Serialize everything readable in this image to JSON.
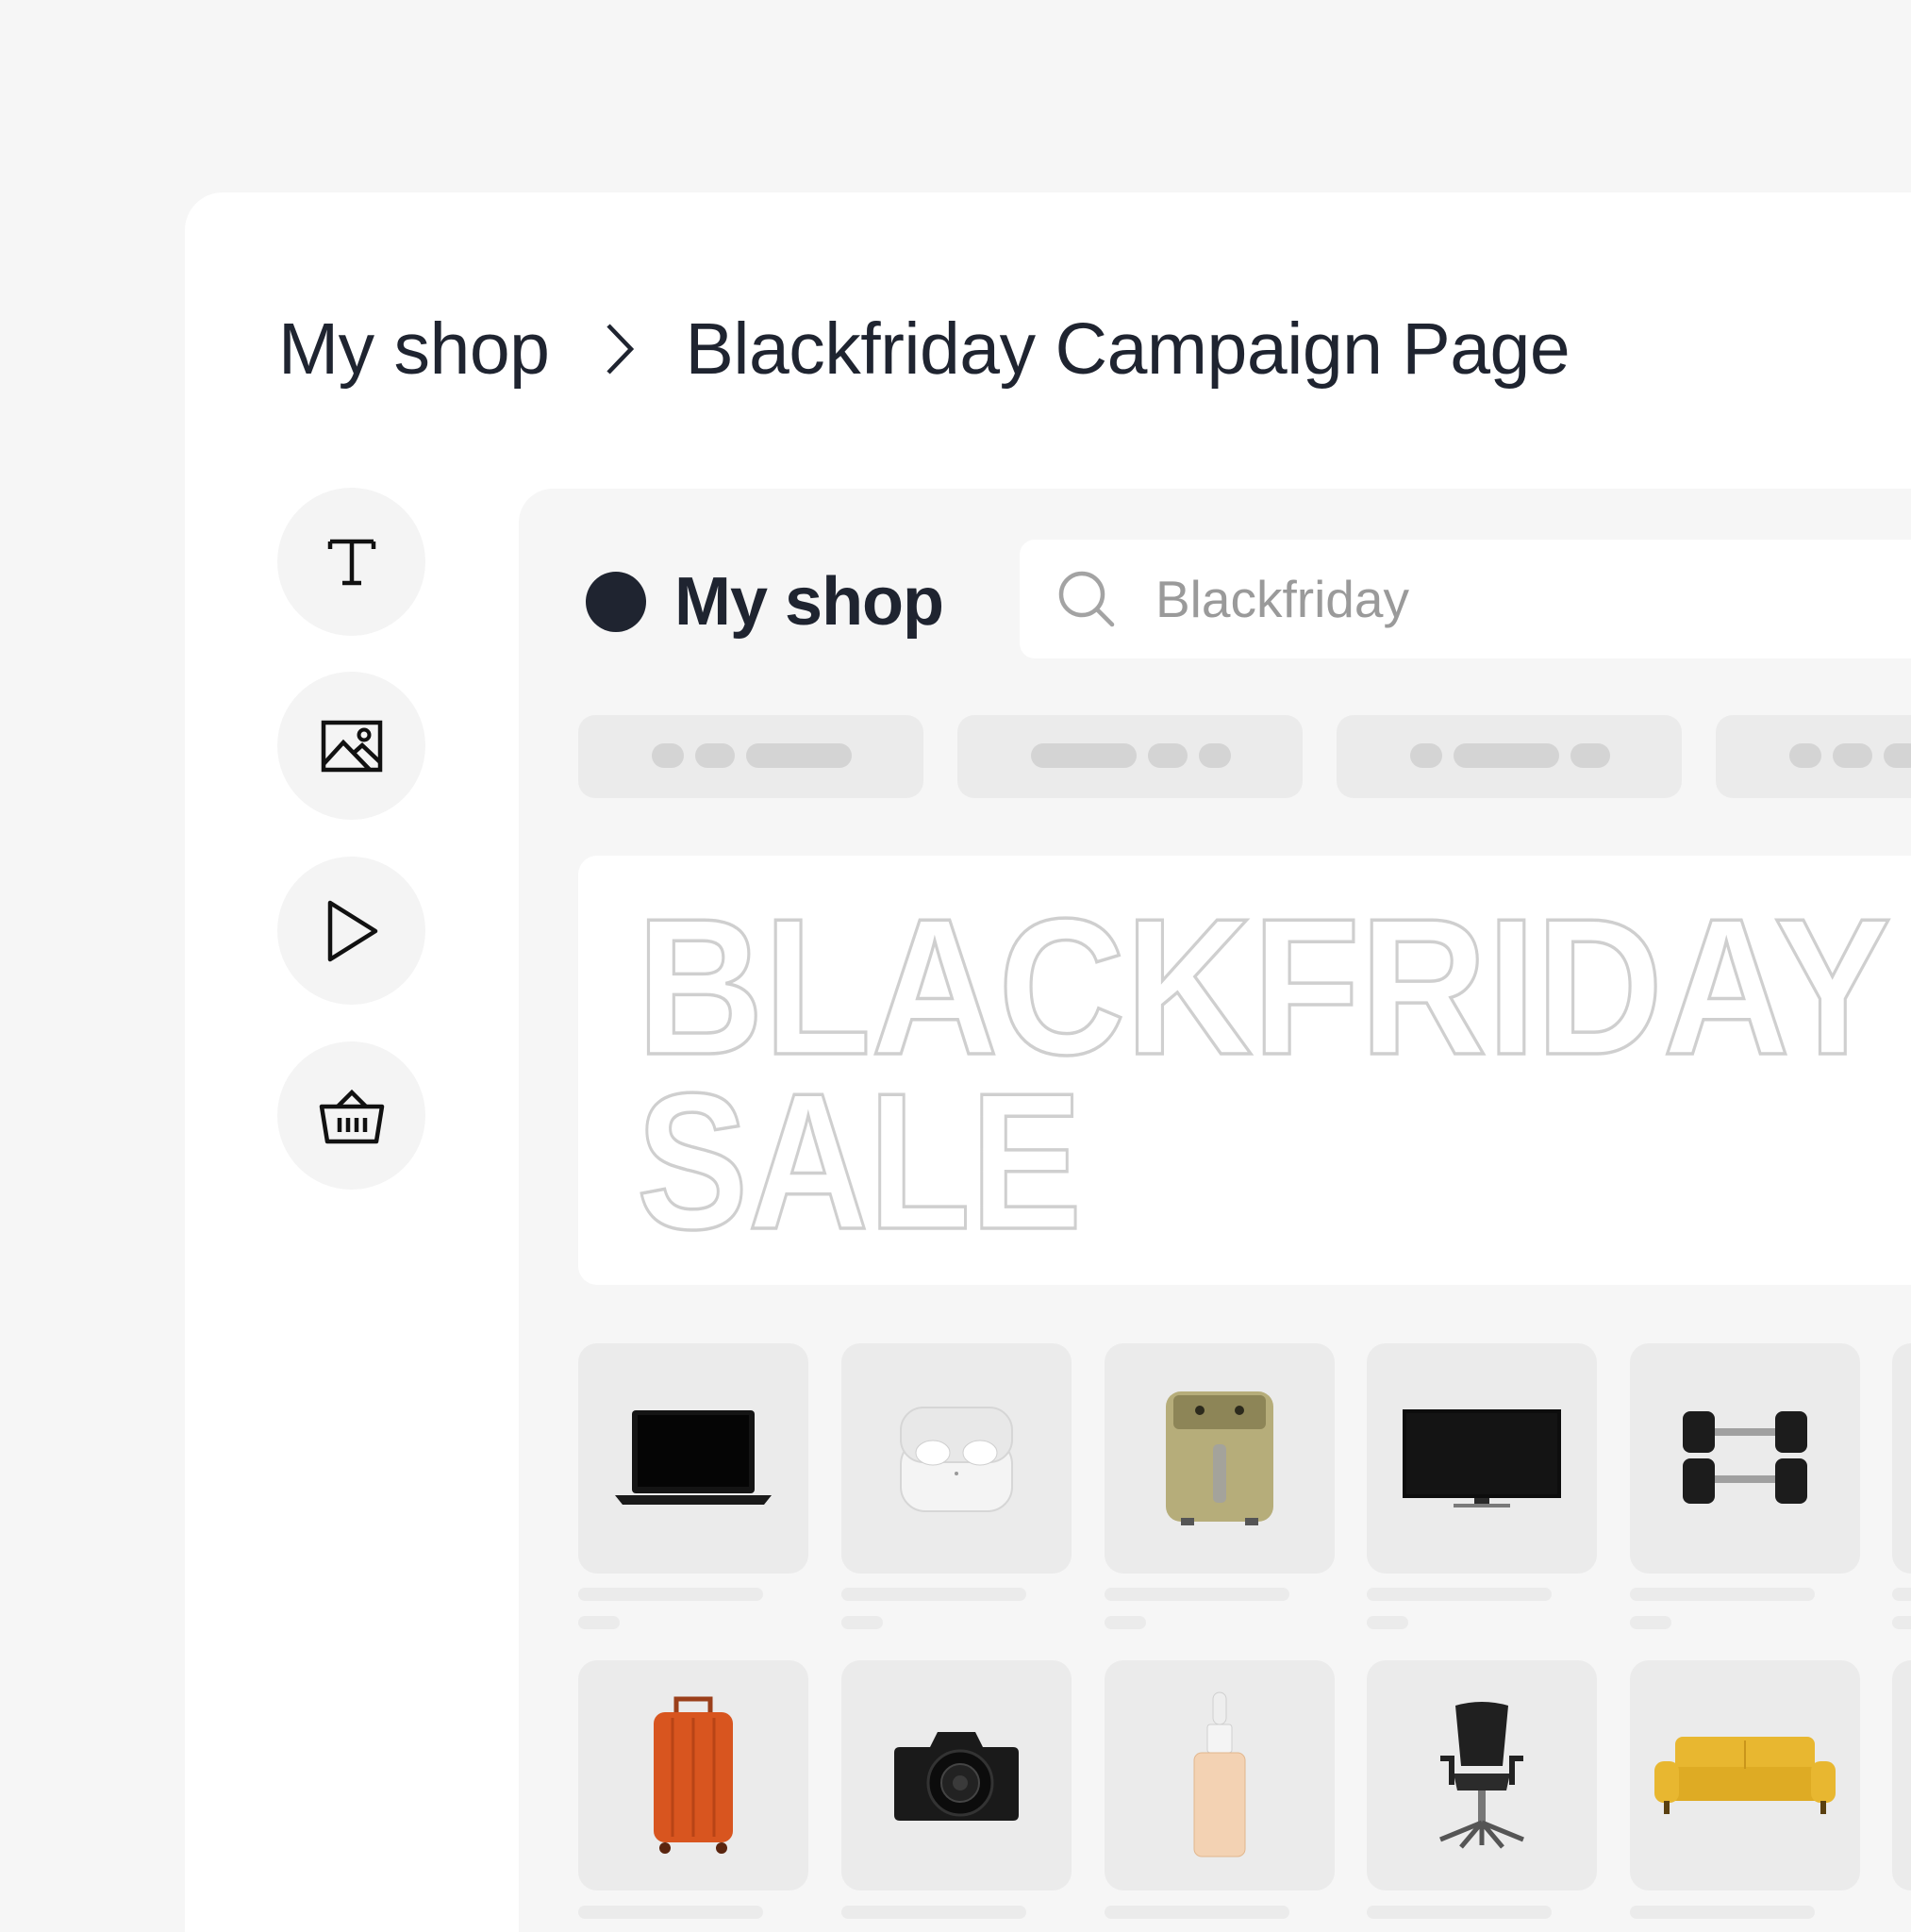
{
  "breadcrumb": {
    "root": "My shop",
    "current": "Blackfriday Campaign Page"
  },
  "tools": [
    {
      "name": "text-tool",
      "icon": "text-icon"
    },
    {
      "name": "image-tool",
      "icon": "image-icon"
    },
    {
      "name": "video-tool",
      "icon": "play-icon"
    },
    {
      "name": "product-tool",
      "icon": "basket-icon"
    }
  ],
  "preview": {
    "brand_name": "My shop",
    "search_value": "Blackfriday",
    "hero": {
      "line1": "BLACKFRIDAY",
      "line2": "SALE"
    },
    "products": [
      {
        "icon": "laptop-icon"
      },
      {
        "icon": "earbuds-icon"
      },
      {
        "icon": "air-fryer-icon"
      },
      {
        "icon": "tv-icon"
      },
      {
        "icon": "dumbbells-icon"
      },
      {
        "icon": "suitcase-icon"
      },
      {
        "icon": "camera-icon"
      },
      {
        "icon": "serum-bottle-icon"
      },
      {
        "icon": "office-chair-icon"
      },
      {
        "icon": "sofa-icon"
      }
    ]
  },
  "colors": {
    "ink": "#1f2430",
    "page_bg": "#f6f6f6",
    "placeholder": "#ebebeb",
    "outline_text": "#cfcfcf"
  }
}
